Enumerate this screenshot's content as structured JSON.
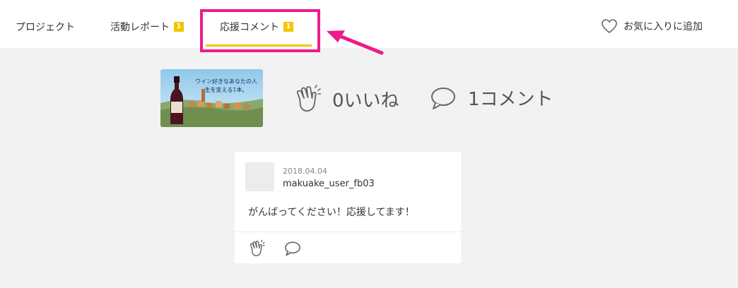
{
  "nav": {
    "tabs": [
      {
        "label": "プロジェクト",
        "badge": ""
      },
      {
        "label": "活動レポート",
        "badge": "1"
      },
      {
        "label": "応援コメント",
        "badge": "1"
      }
    ],
    "favorite_label": "お気に入りに追加"
  },
  "project": {
    "thumbnail_text": "ワイン好きなあなたの人生を変える1本。",
    "likes_label": "0いいね",
    "comments_label": "1コメント"
  },
  "comment": {
    "date": "2018.04.04",
    "user": "makuake_user_fb03",
    "text": "がんばってください！応援してます！"
  },
  "colors": {
    "accent": "#f5c400",
    "highlight": "#ee1b8c"
  }
}
